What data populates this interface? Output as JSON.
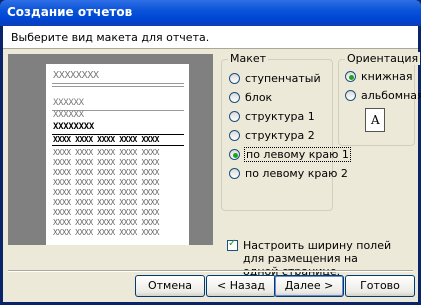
{
  "window": {
    "title": "Создание отчетов"
  },
  "prompt": "Выберите вид макета для отчета.",
  "preview": {
    "title_line": "XXXXXXXX",
    "header_line": "XXXXXX",
    "group_line": "XXXXXXXX",
    "column_header": "XXXX XXXX XXXX XXXX XXXX",
    "row": "XXXX XXXX XXXX XXXX XXXX"
  },
  "layout_group": {
    "label": "Макет",
    "options": [
      {
        "label": "ступенчатый",
        "selected": false
      },
      {
        "label": "блок",
        "selected": false
      },
      {
        "label": "структура 1",
        "selected": false
      },
      {
        "label": "структура 2",
        "selected": false
      },
      {
        "label": "по левому краю 1",
        "selected": true
      },
      {
        "label": "по левому краю 2",
        "selected": false
      }
    ]
  },
  "orientation_group": {
    "label": "Ориентация",
    "options": [
      {
        "label": "книжная",
        "selected": true
      },
      {
        "label": "альбомная",
        "selected": false
      }
    ],
    "icon": "portrait-page-icon",
    "icon_letter": "A"
  },
  "fit_checkbox": {
    "checked": true,
    "label": "Настроить ширину полей для размещения на одной странице."
  },
  "buttons": {
    "cancel": "Отмена",
    "back": "< Назад",
    "next": "Далее >",
    "finish": "Готово"
  }
}
